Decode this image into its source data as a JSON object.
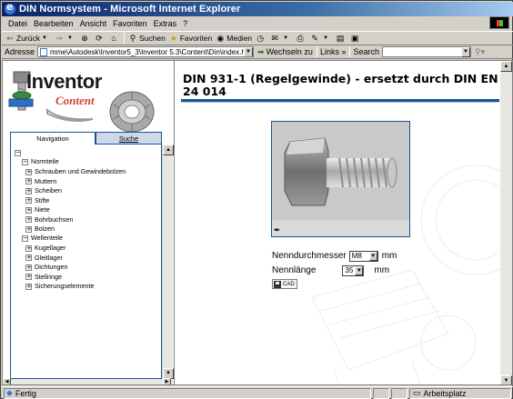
{
  "window": {
    "title": "DIN Normsystem - Microsoft Internet Explorer"
  },
  "menu": [
    "Datei",
    "Bearbeiten",
    "Ansicht",
    "Favoriten",
    "Extras",
    "?"
  ],
  "toolbar": {
    "back": "Zurück",
    "search": "Suchen",
    "favorites": "Favoriten",
    "media": "Medien"
  },
  "addressbar": {
    "label": "Adresse",
    "url": "mme\\Autodesk\\Inventor5_3\\Inventor 5.3\\Content\\Din\\index.htm",
    "go": "Wechseln zu",
    "links": "Links",
    "search_label": "Search"
  },
  "logo": {
    "title": "Inventor",
    "subtitle": "Content"
  },
  "tabs": {
    "navigation": "Navigation",
    "search": "Suche"
  },
  "tree": {
    "normteile": {
      "label": "Normteile",
      "items": [
        "Schrauben und Gewindebolzen",
        "Muttern",
        "Scheiben",
        "Stifte",
        "Niete",
        "Bohrbuchsen",
        "Bolzen"
      ]
    },
    "wellenteile": {
      "label": "Wellenteile",
      "items": [
        "Kugellager",
        "Gleitlager",
        "Dichtungen",
        "Stellringe",
        "Sicherungselemente"
      ]
    }
  },
  "main": {
    "heading": "DIN 931-1 (Regelgewinde) - ersetzt durch DIN EN 24 014",
    "diameter_label": "Nenndurchmesser",
    "diameter_value": "M8",
    "diameter_unit": "mm",
    "length_label": "Nennlänge",
    "length_value": "35",
    "length_unit": "mm",
    "cad_button": "CAD"
  },
  "status": {
    "text": "Fertig",
    "zone": "Arbeitsplatz"
  },
  "colors": {
    "accent": "#16539b",
    "titlebar": "#0a246a"
  }
}
